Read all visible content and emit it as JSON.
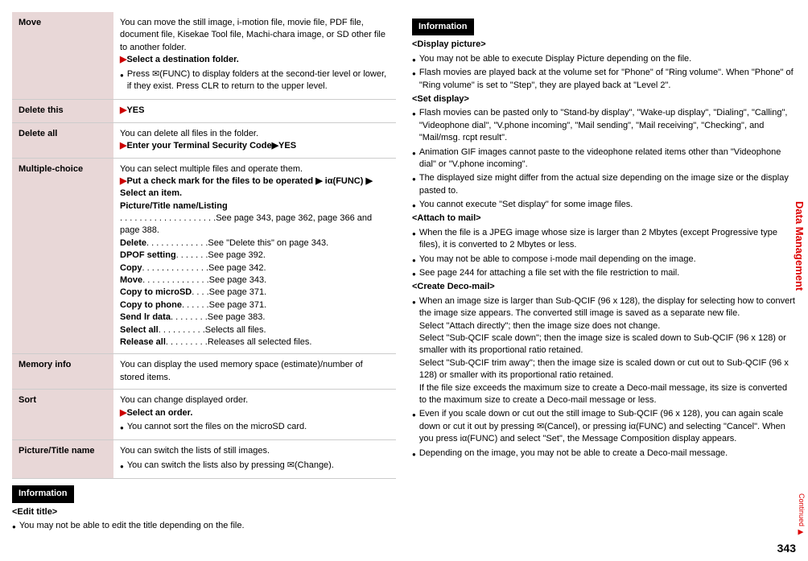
{
  "leftTable": {
    "rows": [
      {
        "label": "Move",
        "desc": "You can move the still image, i-motion file, movie file, PDF file, document file, Kisekae Tool file, Machi-chara image, or SD other file to another folder.",
        "action": "Select a destination folder.",
        "note": "Press ✉(FUNC) to display folders at the second-tier level or lower, if they exist. Press CLR to return to the upper level."
      },
      {
        "label": "Delete this",
        "action": "YES"
      },
      {
        "label": "Delete all",
        "desc": "You can delete all files in the folder.",
        "action": "Enter your Terminal Security Code▶YES"
      },
      {
        "label": "Multiple-choice",
        "desc": "You can select multiple files and operate them.",
        "action": "Put a check mark for the files to be operated ▶ iα(FUNC) ▶ Select an item.",
        "listTitle": "Picture/Title name/Listing",
        "listItems": [
          {
            "k": " . . . . . . . . . . . . . . . . . . . .",
            "v": "See page 343, page 362, page 366 and page 388."
          },
          {
            "k": "Delete. . . . . . . . . . . . .",
            "v": "See \"Delete this\" on page 343."
          },
          {
            "k": "DPOF setting  . . . . . . .",
            "v": "See page 392."
          },
          {
            "k": "Copy  . . . . . . . . . . . . . .",
            "v": "See page 342."
          },
          {
            "k": "Move  . . . . . . . . . . . . . .",
            "v": "See page 343."
          },
          {
            "k": "Copy to microSD . . . .",
            "v": "See page 371."
          },
          {
            "k": "Copy to phone . . . . . .",
            "v": "See page 371."
          },
          {
            "k": "Send lr data  . . . . . . . .",
            "v": "See page 383."
          },
          {
            "k": "Select all . . . . . . . . . .",
            "v": "Selects all files."
          },
          {
            "k": "Release all. . . . . . . . .",
            "v": "Releases all selected files."
          }
        ]
      },
      {
        "label": "Memory info",
        "desc": "You can display the used memory space (estimate)/number of stored items."
      },
      {
        "label": "Sort",
        "desc": "You can change displayed order.",
        "action": "Select an order.",
        "note": "You cannot sort the files on the microSD card."
      },
      {
        "label": "Picture/Title name",
        "desc": "You can switch the lists of still images.",
        "note": "You can switch the lists also by pressing ✉(Change)."
      }
    ]
  },
  "leftInfo": {
    "title": "Information",
    "header": "<Edit title>",
    "b1": "You may not be able to edit the title depending on the file."
  },
  "rightInfo": {
    "title": "Information",
    "sections": [
      {
        "header": "<Display picture>",
        "bullets": [
          "You may not be able to execute Display Picture depending on the file.",
          "Flash movies are played back at the volume set for \"Phone\" of \"Ring volume\". When \"Phone\" of \"Ring volume\" is set to \"Step\", they are played back at \"Level 2\"."
        ]
      },
      {
        "header": "<Set display>",
        "bullets": [
          "Flash movies can be pasted only to \"Stand-by display\", \"Wake-up display\", \"Dialing\", \"Calling\", \"Videophone dial\", \"V.phone incoming\", \"Mail sending\", \"Mail receiving\", \"Checking\", and \"Mail/msg. rcpt result\".",
          "Animation GIF images cannot paste to the videophone related items other than \"Videophone dial\" or \"V.phone incoming\".",
          "The displayed size might differ from the actual size depending on the image size or the display pasted to.",
          "You cannot execute \"Set display\" for some image files."
        ]
      },
      {
        "header": "<Attach to mail>",
        "bullets": [
          "When the file is a JPEG image whose size is larger than 2 Mbytes (except Progressive type files), it is converted to 2 Mbytes or less.",
          "You may not be able to compose i-mode mail depending on the image.",
          "See page 244 for attaching a file set with the file restriction to mail."
        ]
      },
      {
        "header": "<Create Deco-mail>",
        "bullets": [
          "When an image size is larger than Sub-QCIF (96 x 128), the display for selecting how to convert the image size appears. The converted still image is saved as a separate new file.\nSelect \"Attach directly\"; then the image size does not change.\nSelect \"Sub-QCIF scale down\"; then the image size is scaled down to Sub-QCIF (96 x 128) or smaller with its proportional ratio retained.\nSelect \"Sub-QCIF trim away\"; then the image size is scaled down or cut out to Sub-QCIF (96 x 128) or smaller with its proportional ratio retained.\nIf the file size exceeds the maximum size to create a Deco-mail message, its size is converted to the maximum size to create a Deco-mail message or less.",
          "Even if you scale down or cut out the still image to Sub-QCIF (96 x 128), you can again scale down or cut it out by pressing ✉(Cancel), or pressing iα(FUNC) and selecting \"Cancel\". When you press iα(FUNC) and select \"Set\", the Message Composition display appears.",
          "Depending on the image, you may not be able to create a Deco-mail message."
        ]
      }
    ]
  },
  "side": "Data Management",
  "pagenum": "343",
  "cont": "Continued ▶"
}
